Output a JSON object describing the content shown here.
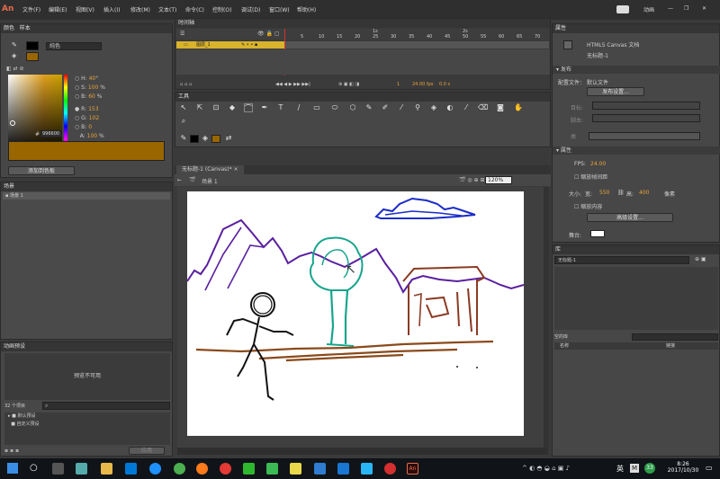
{
  "app": {
    "logo": "An",
    "workspace": "动画"
  },
  "menu": [
    "文件(F)",
    "编辑(E)",
    "视图(V)",
    "插入(I)",
    "修改(M)",
    "文本(T)",
    "命令(C)",
    "控制(O)",
    "调试(D)",
    "窗口(W)",
    "帮助(H)"
  ],
  "color_panel": {
    "tabs": [
      "颜色",
      "样本"
    ],
    "type": "纯色",
    "H": "40",
    "S": "100",
    "Bv": "60",
    "R": "153",
    "G": "102",
    "B": "0",
    "A": "100",
    "hex": "996600",
    "add_swatch": "添加到色板",
    "pct": "%",
    "deg": "°",
    "hash": "#",
    "fill_color": "#996600"
  },
  "scene_panel": {
    "title": "场景",
    "item": "场景 1"
  },
  "motion_panel": {
    "title": "动画预设",
    "preview": "预览不可用",
    "count": "32 个项目",
    "folders": [
      "默认预设",
      "自定义预设"
    ],
    "apply": "应用"
  },
  "timeline": {
    "title": "时间轴",
    "layer": "图层_1",
    "ruler": [
      "1s",
      "2s"
    ],
    "frames": [
      "5",
      "10",
      "15",
      "20",
      "25",
      "30",
      "35",
      "40",
      "45",
      "50",
      "55",
      "60",
      "65",
      "70"
    ],
    "frame": "1",
    "fps": "24.00 fps",
    "time": "0.0 s"
  },
  "tools": {
    "title": "工具"
  },
  "document": {
    "tab": "无标题-1 (Canvas)*",
    "scene": "场景 1",
    "zoom": "120%"
  },
  "properties": {
    "tabs": [
      "属性",
      "库"
    ],
    "doc_type": "HTML5 Canvas 文档",
    "doc_name": "无标题-1",
    "publish_title": "发布",
    "profile_label": "配置文件：",
    "profile_value": "默认文件",
    "publish_settings": "发布设置...",
    "target_label": "目标:",
    "script_label": "脚本:",
    "class_label": "类",
    "props_title": "属性",
    "fps_label": "FPS:",
    "fps_value": "24.00",
    "scale_spans": "缩放帧间距",
    "size_label": "大小:",
    "width_label": "宽:",
    "width_value": "550",
    "height_label": "高:",
    "height_value": "400",
    "unit": "像素",
    "scale_content": "缩放内容",
    "advanced": "高级设置...",
    "stage_label": "舞台:"
  },
  "library": {
    "title": "库",
    "doc": "无标题-1",
    "empty": "空的库",
    "col_name": "名称",
    "col_link": "链接"
  },
  "taskbar": {
    "ime": "英",
    "time": "8:26",
    "date": "2017/10/30",
    "badge": "33"
  },
  "colors": {
    "accent": "#e66b4a",
    "layer_highlight": "#d8b32c",
    "playhead": "#d9302c",
    "drawing_purple": "#5a1fa0",
    "drawing_blue": "#1a2cc8",
    "drawing_teal": "#17a58c",
    "drawing_brown": "#8a3a22",
    "drawing_black": "#111111"
  }
}
